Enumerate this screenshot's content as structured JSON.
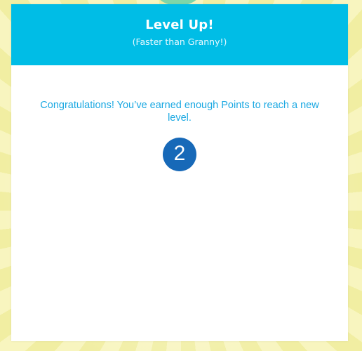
{
  "dialog": {
    "title": "Level Up!",
    "subtitle": "(Faster than Granny!)",
    "message": "Congratulations! You’ve earned enough Points to reach a new level.",
    "level": "2"
  },
  "colors": {
    "header": "#00bde6",
    "message_text": "#1aa8e2",
    "level_badge": "#1769b8",
    "backdrop": "#f6f3b0",
    "top_tab": "#7fd6a8"
  }
}
